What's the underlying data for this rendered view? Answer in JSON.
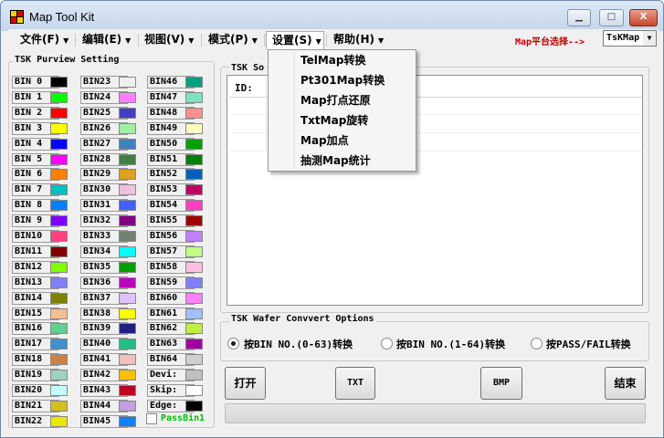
{
  "window": {
    "title": "Map Tool Kit",
    "minimize_label": "▁",
    "maximize_label": "□",
    "close_label": "X"
  },
  "menu": [
    {
      "label": "文件(F)"
    },
    {
      "label": "编辑(E)"
    },
    {
      "label": "视图(V)"
    },
    {
      "label": "模式(P)"
    },
    {
      "label": "设置(S)"
    },
    {
      "label": "帮助(H)"
    }
  ],
  "map_platform": {
    "label": "Map平台选择-->",
    "value": "TsKMap"
  },
  "settings_menu": {
    "items": [
      "TelMap转换",
      "Pt301Map转换",
      "Map打点还原",
      "TxtMap旋转",
      "Map加点",
      "抽测Map统计"
    ]
  },
  "purview": {
    "title": "TSK Purview Setting",
    "col1": [
      {
        "label": "BIN 0",
        "color": "#000000"
      },
      {
        "label": "BIN 1",
        "color": "#00ff00"
      },
      {
        "label": "BIN 2",
        "color": "#ff0000"
      },
      {
        "label": "BIN 3",
        "color": "#ffff00"
      },
      {
        "label": "BIN 4",
        "color": "#0000ff"
      },
      {
        "label": "BIN 5",
        "color": "#ff00ff"
      },
      {
        "label": "BIN 6",
        "color": "#ff8000"
      },
      {
        "label": "BIN 7",
        "color": "#00c0c0"
      },
      {
        "label": "BIN 8",
        "color": "#0080ff"
      },
      {
        "label": "BIN 9",
        "color": "#8000ff"
      },
      {
        "label": "BIN10",
        "color": "#ff4080"
      },
      {
        "label": "BIN11",
        "color": "#800000"
      },
      {
        "label": "BIN12",
        "color": "#80ff00"
      },
      {
        "label": "BIN13",
        "color": "#8080ff"
      },
      {
        "label": "BIN14",
        "color": "#808000"
      },
      {
        "label": "BIN15",
        "color": "#f0c090"
      },
      {
        "label": "BIN16",
        "color": "#60d090"
      },
      {
        "label": "BIN17",
        "color": "#4090d0"
      },
      {
        "label": "BIN18",
        "color": "#d08040"
      },
      {
        "label": "BIN19",
        "color": "#a0d0c0"
      },
      {
        "label": "BIN20",
        "color": "#c0ffff"
      },
      {
        "label": "BIN21",
        "color": "#d0c020"
      },
      {
        "label": "BIN22",
        "color": "#e8e800"
      }
    ],
    "col2": [
      {
        "label": "BIN23",
        "color": "#f0f0f0"
      },
      {
        "label": "BIN24",
        "color": "#ff80ff"
      },
      {
        "label": "BIN25",
        "color": "#4040c0"
      },
      {
        "label": "BIN26",
        "color": "#a0f0a0"
      },
      {
        "label": "BIN27",
        "color": "#4080c0"
      },
      {
        "label": "BIN28",
        "color": "#408040"
      },
      {
        "label": "BIN29",
        "color": "#e0a020"
      },
      {
        "label": "BIN30",
        "color": "#f0c0e0"
      },
      {
        "label": "BIN31",
        "color": "#4060ff"
      },
      {
        "label": "BIN32",
        "color": "#800080"
      },
      {
        "label": "BIN33",
        "color": "#708070"
      },
      {
        "label": "BIN34",
        "color": "#00ffff"
      },
      {
        "label": "BIN35",
        "color": "#00a000"
      },
      {
        "label": "BIN36",
        "color": "#c000c0"
      },
      {
        "label": "BIN37",
        "color": "#e0c0ff"
      },
      {
        "label": "BIN38",
        "color": "#ffff00"
      },
      {
        "label": "BIN39",
        "color": "#202080"
      },
      {
        "label": "BIN40",
        "color": "#20c080"
      },
      {
        "label": "BIN41",
        "color": "#f0c0c0"
      },
      {
        "label": "BIN42",
        "color": "#ffc000"
      },
      {
        "label": "BIN43",
        "color": "#c00020"
      },
      {
        "label": "BIN44",
        "color": "#c0a0e0"
      },
      {
        "label": "BIN45",
        "color": "#1080f0"
      }
    ],
    "col3": [
      {
        "label": "BIN46",
        "color": "#00a080"
      },
      {
        "label": "BIN47",
        "color": "#80e0c0"
      },
      {
        "label": "BIN48",
        "color": "#ff9090"
      },
      {
        "label": "BIN49",
        "color": "#ffffc0"
      },
      {
        "label": "BIN50",
        "color": "#00a000"
      },
      {
        "label": "BIN51",
        "color": "#008000"
      },
      {
        "label": "BIN52",
        "color": "#0060c0"
      },
      {
        "label": "BIN53",
        "color": "#c00060"
      },
      {
        "label": "BIN54",
        "color": "#ff40c0"
      },
      {
        "label": "BIN55",
        "color": "#a00000"
      },
      {
        "label": "BIN56",
        "color": "#c080ff"
      },
      {
        "label": "BIN57",
        "color": "#c0ff80"
      },
      {
        "label": "BIN58",
        "color": "#ffc0e0"
      },
      {
        "label": "BIN59",
        "color": "#8080ff"
      },
      {
        "label": "BIN60",
        "color": "#ff80ff"
      },
      {
        "label": "BIN61",
        "color": "#a0c0ff"
      },
      {
        "label": "BIN62",
        "color": "#c0f040"
      },
      {
        "label": "BIN63",
        "color": "#a000a0"
      },
      {
        "label": "BIN64",
        "color": "#d0d0d0"
      },
      {
        "label": "Devi:",
        "color": "#c0c0c0"
      },
      {
        "label": "Skip:",
        "color": "#ffffff"
      },
      {
        "label": "Edge:",
        "color": "#000000"
      }
    ],
    "passbin_label": "PassBin1"
  },
  "tsk_box": {
    "title": "TSK So",
    "column_header": "ID:"
  },
  "convert": {
    "title": "TSK Wafer Convvert Options",
    "options": [
      "按BIN NO.(0-63)转换",
      "按BIN NO.(1-64)转换",
      "按PASS/FAIL转换"
    ],
    "selected_index": 0
  },
  "buttons": {
    "open": "打开",
    "txt": "TXT",
    "bmp": "BMP",
    "finish": "结束"
  }
}
